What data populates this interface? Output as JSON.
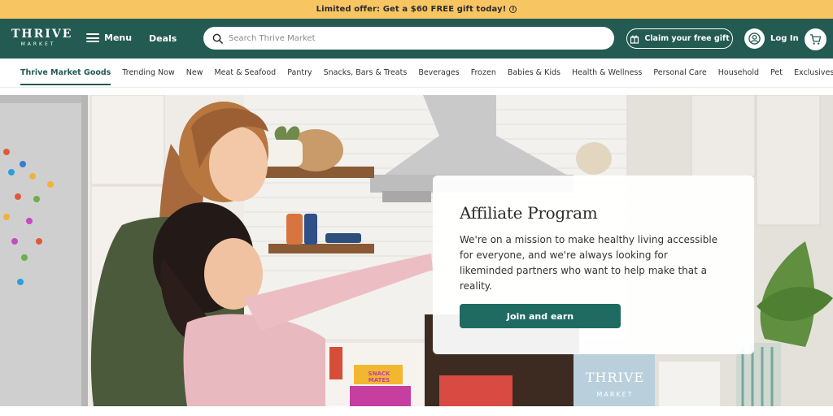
{
  "promo": {
    "text": "Limited offer: Get a $60 FREE gift today!",
    "info_icon": "info-icon"
  },
  "header": {
    "logo_top": "THRIVE",
    "logo_bottom": "MARKET",
    "menu_label": "Menu",
    "deals_label": "Deals",
    "search_placeholder": "Search Thrive Market",
    "gift_label": "Claim your free gift",
    "login_label": "Log In",
    "colors": {
      "header_bg": "#235a52",
      "promo_bg": "#f7c562",
      "accent": "#1f6b61"
    }
  },
  "categories": [
    "Thrive Market Goods",
    "Trending Now",
    "New",
    "Meat & Seafood",
    "Pantry",
    "Snacks, Bars & Treats",
    "Beverages",
    "Frozen",
    "Babies & Kids",
    "Health & Wellness",
    "Personal Care",
    "Household",
    "Pet",
    "Exclusives"
  ],
  "hero": {
    "title": "Affiliate Program",
    "body": "We're on a mission to make healthy living accessible for everyone, and we're always looking for likeminded partners who want to help make that a reality.",
    "cta": "Join and earn",
    "product_labels": {
      "snack": "SNACK MATES",
      "box_top": "THRIVE",
      "box_bottom": "MARKET"
    }
  }
}
